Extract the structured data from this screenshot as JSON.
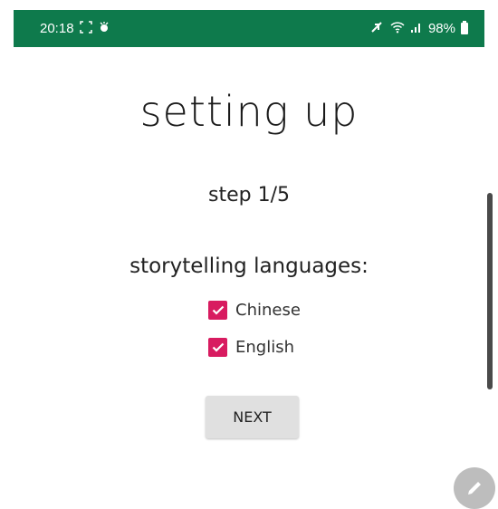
{
  "status_bar": {
    "time": "20:18",
    "left_icons": [
      "screenshot-icon",
      "notification-icon"
    ],
    "right_icons": [
      "mute-icon",
      "wifi-icon",
      "signal-icon"
    ],
    "battery_text": "98%",
    "background_color": "#0e7a4c"
  },
  "page": {
    "title": "setting up",
    "step": "step 1/5",
    "languages_label": "storytelling languages:"
  },
  "languages": [
    {
      "label": "Chinese",
      "checked": true
    },
    {
      "label": "English",
      "checked": true
    }
  ],
  "next_button": {
    "label": "NEXT"
  },
  "colors": {
    "checkbox_accent": "#d81b60",
    "button_bg": "#e0e0e0",
    "fab_bg": "#bdbdbd"
  }
}
